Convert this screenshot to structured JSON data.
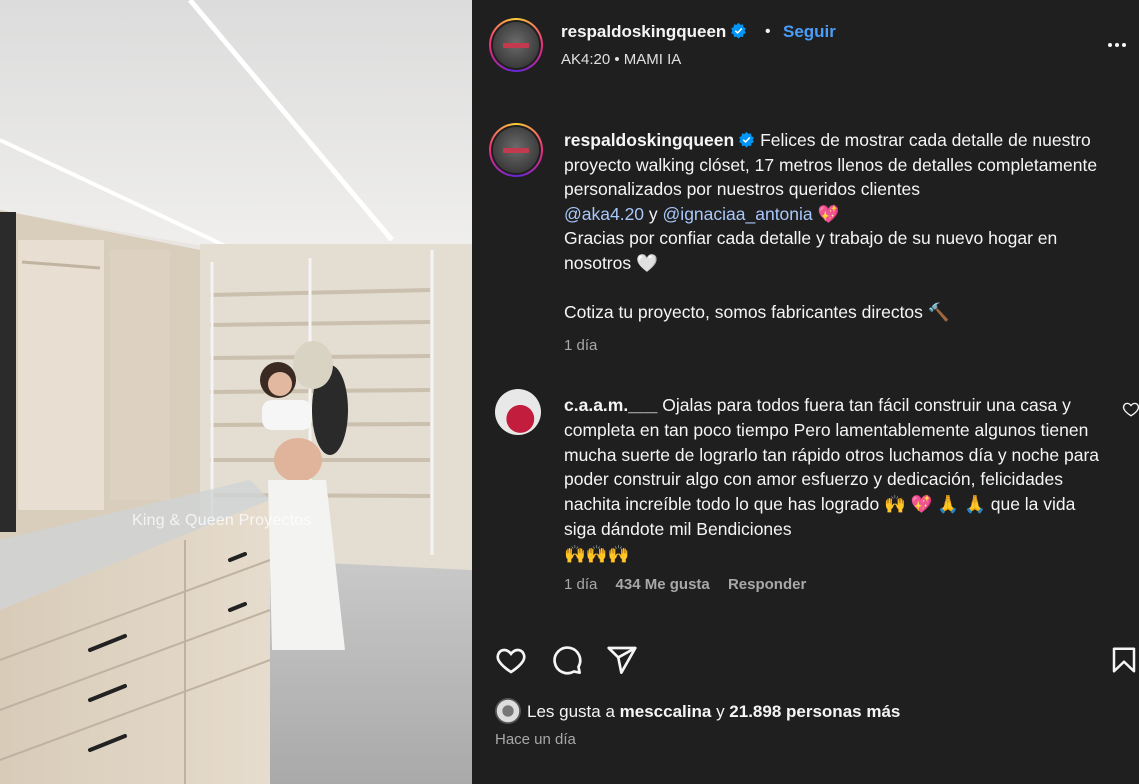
{
  "photo": {
    "watermark": "King & Queen Proyectos"
  },
  "post": {
    "username": "respaldoskingqueen",
    "follow_label": "Seguir",
    "audio": "AK4:20 • MAMI IA"
  },
  "caption": {
    "username": "respaldoskingqueen",
    "line1": "Felices de mostrar cada detalle de nuestro proyecto walking clóset, 17 metros llenos de detalles completamente personalizados por nuestros queridos clientes",
    "mention1": "@aka4.20",
    "connector": "y",
    "mention2": "@ignaciaa_antonia",
    "emoji1": "💖",
    "line2": "Gracias por confiar cada detalle y trabajo de su nuevo hogar en nosotros",
    "emoji2": "🤍",
    "line3": "Cotiza tu proyecto, somos fabricantes directos",
    "emoji3": "🔨",
    "time": "1 día"
  },
  "comment": {
    "username": "c.a.a.m.___",
    "text": "Ojalas para todos fuera tan fácil construir una casa y completa en tan poco tiempo Pero lamentablemente algunos tienen mucha suerte de lograrlo tan rápido otros luchamos día y noche para poder construir algo con amor esfuerzo y dedicación, felicidades nachita increíble todo lo que has logrado",
    "emojis": "🙌 💖  🙏 🙏",
    "text2": "que la vida siga dándote mil Bendiciones",
    "emojis2": "🙌🙌🙌",
    "time": "1 día",
    "likes": "434 Me gusta",
    "reply_label": "Responder"
  },
  "likes": {
    "prefix": "Les gusta a",
    "user": "mesccalina",
    "connector": "y",
    "others": "21.898 personas más"
  },
  "posted": "Hace un día",
  "icons": [
    "heart-icon",
    "comment-icon",
    "share-icon",
    "bookmark-icon",
    "more-icon",
    "verified-icon"
  ],
  "colors": {
    "panel": "#1f1f1f",
    "link": "#4a9df8",
    "mention": "#a8c7fa",
    "muted": "#a8a8a8",
    "verified": "#0095f6"
  }
}
